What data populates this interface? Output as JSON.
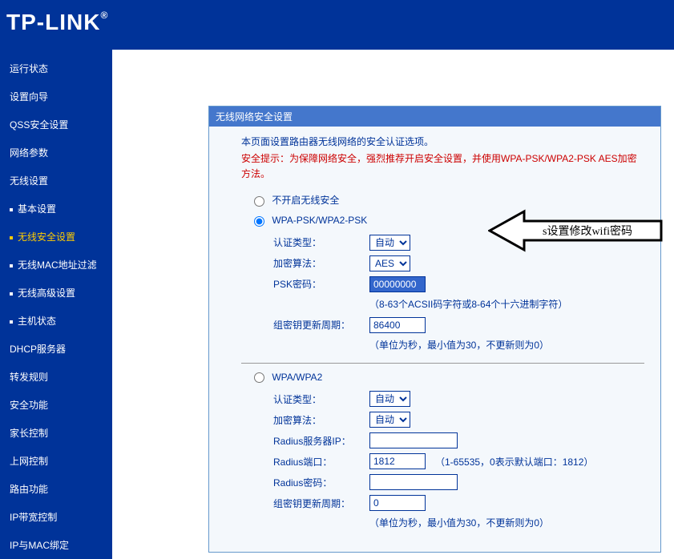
{
  "logo": "TP-LINK",
  "sidebar": {
    "items": [
      {
        "label": "运行状态"
      },
      {
        "label": "设置向导"
      },
      {
        "label": "QSS安全设置"
      },
      {
        "label": "网络参数"
      },
      {
        "label": "无线设置"
      }
    ],
    "subs": [
      {
        "label": "基本设置"
      },
      {
        "label": "无线安全设置"
      },
      {
        "label": "无线MAC地址过滤"
      },
      {
        "label": "无线高级设置"
      },
      {
        "label": "主机状态"
      }
    ],
    "items2": [
      {
        "label": "DHCP服务器"
      },
      {
        "label": "转发规则"
      },
      {
        "label": "安全功能"
      },
      {
        "label": "家长控制"
      },
      {
        "label": "上网控制"
      },
      {
        "label": "路由功能"
      },
      {
        "label": "IP带宽控制"
      },
      {
        "label": "IP与MAC绑定"
      }
    ]
  },
  "panel": {
    "title": "无线网络安全设置",
    "intro": "本页面设置路由器无线网络的安全认证选项。",
    "warning": "安全提示：为保障网络安全，强烈推荐开启安全设置，并使用WPA-PSK/WPA2-PSK AES加密方法。"
  },
  "radios": {
    "none": "不开启无线安全",
    "wpapsk": "WPA-PSK/WPA2-PSK",
    "wpa": "WPA/WPA2"
  },
  "section1": {
    "auth_label": "认证类型：",
    "auth_value": "自动",
    "enc_label": "加密算法：",
    "enc_value": "AES",
    "psk_label": "PSK密码：",
    "psk_value": "00000000",
    "psk_hint": "（8-63个ACSII码字符或8-64个十六进制字符）",
    "gk_label": "组密钥更新周期：",
    "gk_value": "86400",
    "gk_hint": "（单位为秒，最小值为30，不更新则为0）"
  },
  "section2": {
    "auth_label": "认证类型：",
    "auth_value": "自动",
    "enc_label": "加密算法：",
    "enc_value": "自动",
    "ip_label": "Radius服务器IP：",
    "ip_value": "",
    "port_label": "Radius端口：",
    "port_value": "1812",
    "port_hint": "（1-65535，0表示默认端口：1812）",
    "pwd_label": "Radius密码：",
    "pwd_value": "",
    "gk_label": "组密钥更新周期：",
    "gk_value": "0",
    "gk_hint": "（单位为秒，最小值为30，不更新则为0）"
  },
  "annotation": "s设置修改wifi密码"
}
